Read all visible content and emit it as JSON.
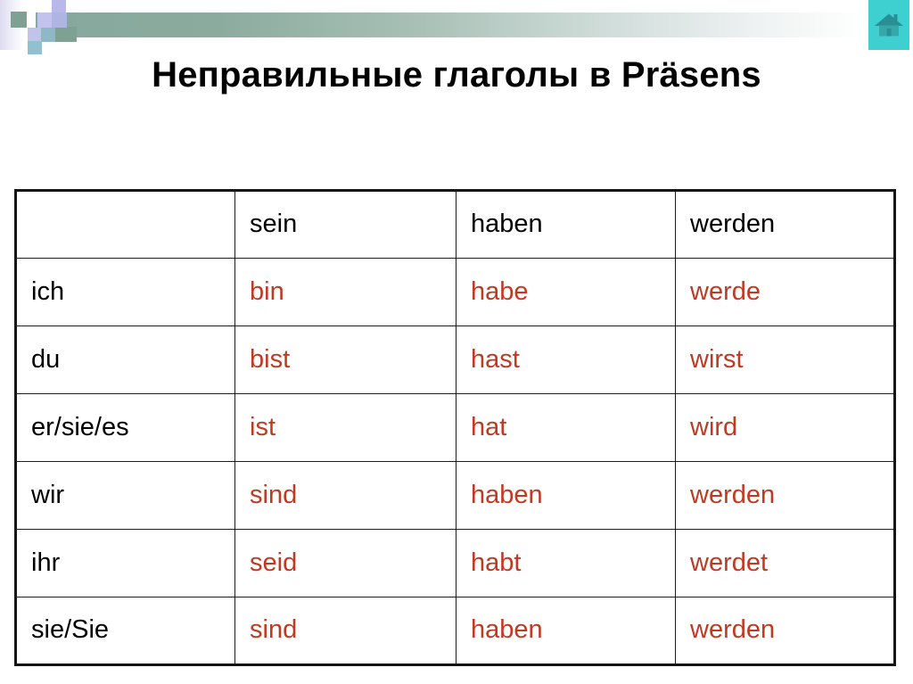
{
  "slide": {
    "title": "Неправильные глаголы в Präsens",
    "background_color": "#ffffff"
  },
  "header": {
    "gradient_from": "#86a89c",
    "gradient_to": "#ffffff",
    "home_icon_name": "home-icon",
    "home_icon_bg": "#3ecfd0",
    "home_icon_fill": "#2a8f95",
    "decor_squares": [
      {
        "name": "square-sage",
        "color": "#7fa193"
      },
      {
        "name": "square-lavender-top",
        "color": "#b9b8ea"
      },
      {
        "name": "square-lavender",
        "color": "#c3c2ee"
      },
      {
        "name": "square-periwinkle",
        "color": "#aeb5e2"
      },
      {
        "name": "square-light-blue",
        "color": "#c0c3ea"
      },
      {
        "name": "square-steel-blue",
        "color": "#8fb7c6"
      },
      {
        "name": "square-blue-teal",
        "color": "#93c0cf"
      }
    ]
  },
  "table": {
    "accent_color": "#c03a22",
    "label_color": "#000000",
    "border_color": "#161616",
    "columns": [
      "",
      "sein",
      "haben",
      "werden"
    ],
    "rows": [
      {
        "pronoun": "ich",
        "sein": "bin",
        "haben": "habe",
        "werden": "werde"
      },
      {
        "pronoun": "du",
        "sein": "bist",
        "haben": "hast",
        "werden": "wirst"
      },
      {
        "pronoun": "er/sie/es",
        "sein": "ist",
        "haben": "hat",
        "werden": "wird"
      },
      {
        "pronoun": "wir",
        "sein": "sind",
        "haben": "haben",
        "werden": "werden"
      },
      {
        "pronoun": "ihr",
        "sein": "seid",
        "haben": "habt",
        "werden": "werdet"
      },
      {
        "pronoun": "sie/Sie",
        "sein": "sind",
        "haben": "haben",
        "werden": "werden"
      }
    ]
  }
}
